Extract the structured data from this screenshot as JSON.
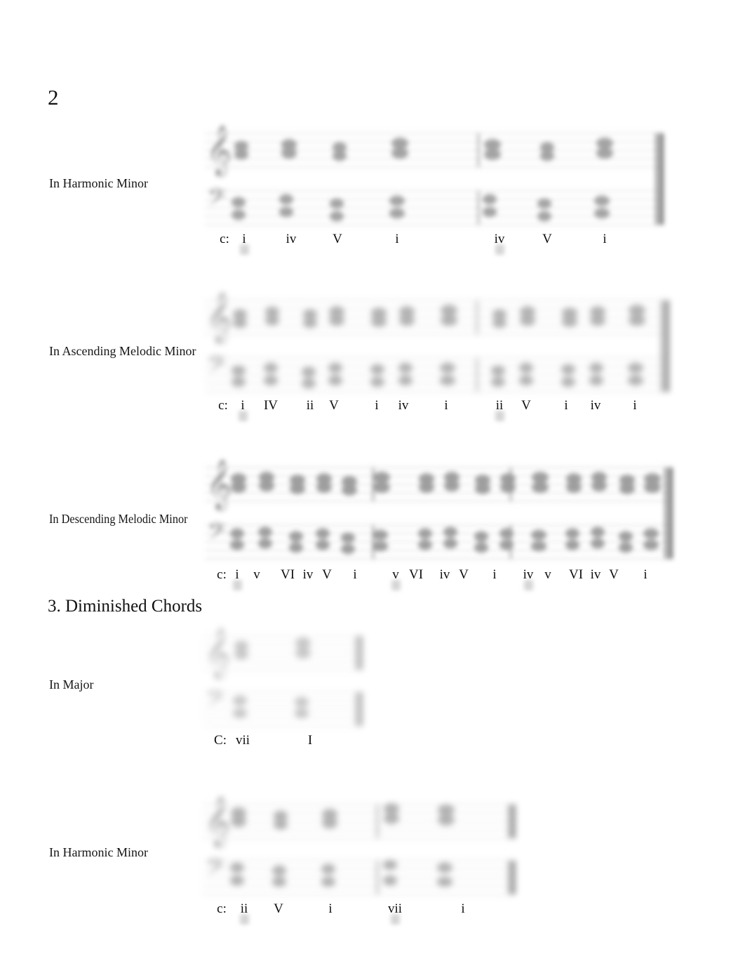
{
  "document": {
    "page_number": "2",
    "section_heading": "3. Diminished Chords"
  },
  "systems": [
    {
      "id": "harmonic-minor",
      "label": "In Harmonic Minor",
      "key_label": "c:",
      "numerals": [
        "i",
        "iv",
        "V",
        "i",
        "iv",
        "V",
        "i"
      ]
    },
    {
      "id": "ascending-melodic-minor",
      "label": "In Ascending Melodic Minor",
      "key_label": "c:",
      "numerals": [
        "i",
        "IV",
        "ii",
        "V",
        "i",
        "iv",
        "i",
        "ii",
        "V",
        "i",
        "iv",
        "i"
      ]
    },
    {
      "id": "descending-melodic-minor",
      "label": "In Descending Melodic Minor",
      "key_label": "c:",
      "numerals": [
        "i",
        "v",
        "VI",
        "iv",
        "V",
        "i",
        "v",
        "VI",
        "iv",
        "V",
        "i",
        "iv",
        "v",
        "VI",
        "iv",
        "V",
        "i"
      ]
    },
    {
      "id": "diminished-major",
      "label": "In Major",
      "key_label": "C:",
      "numerals": [
        "vii",
        "I"
      ]
    },
    {
      "id": "diminished-harmonic-minor",
      "label": "In Harmonic Minor",
      "key_label": "c:",
      "numerals": [
        "ii",
        "V",
        "i",
        "vii",
        "i"
      ]
    }
  ],
  "notation": {
    "treble_clef_glyph": "𝄞",
    "bass_clef_glyph": "𝄢",
    "staff_line_color": "#d8d8d8",
    "note_color": "#9a9a9a",
    "barline_color": "#8e8e8e"
  }
}
